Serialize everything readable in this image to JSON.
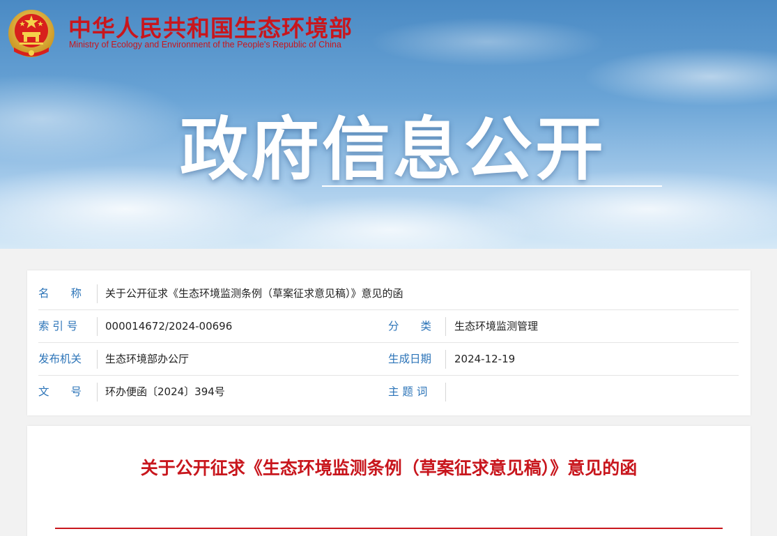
{
  "header": {
    "site_title": "中华人民共和国生态环境部",
    "site_subtitle": "Ministry of Ecology and Environment of the People's Republic of China",
    "emblem_icon": "national-emblem-icon"
  },
  "banner": {
    "hero_title": "政府信息公开"
  },
  "meta": {
    "name_label": "名　　称",
    "name_value": "关于公开征求《生态环境监测条例（草案征求意见稿）》意见的函",
    "index_label": "索 引 号",
    "index_value": "000014672/2024-00696",
    "category_label": "分　　类",
    "category_value": "生态环境监测管理",
    "issuer_label": "发布机关",
    "issuer_value": "生态环境部办公厅",
    "date_label": "生成日期",
    "date_value": "2024-12-19",
    "docno_label": "文　　号",
    "docno_value": "环办便函〔2024〕394号",
    "keywords_label": "主 题 词",
    "keywords_value": ""
  },
  "document": {
    "title": "关于公开征求《生态环境监测条例（草案征求意见稿）》意见的函"
  },
  "colors": {
    "brand_red": "#c8161d",
    "label_blue": "#2c74b8"
  }
}
